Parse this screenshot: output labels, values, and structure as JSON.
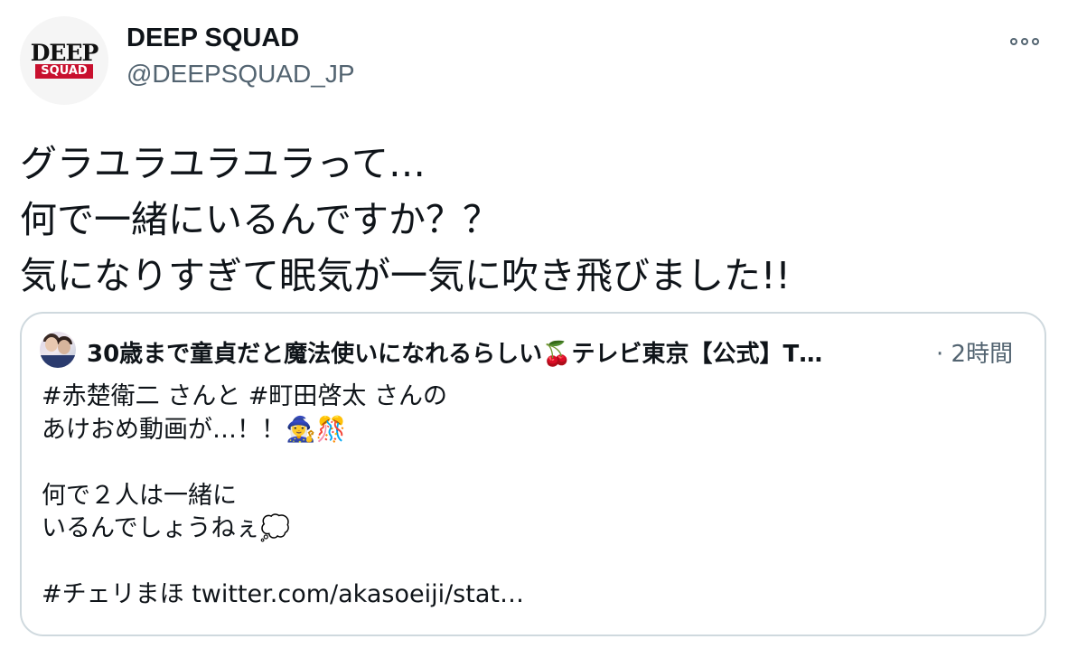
{
  "author": {
    "display_name": "DEEP SQUAD",
    "handle": "@DEEPSQUAD_JP",
    "avatar_logo_top": "DEEP",
    "avatar_logo_bottom": "SQUAD"
  },
  "more_icon": "more-horizontal-icon",
  "tweet_text": "グラユラユラユラって…\n何で一緒にいるんですか？？\n気になりすぎて眠気が一気に吹き飛びました!!",
  "quote": {
    "display_name": "30歳まで童貞だと魔法使いになれるらしい🍒テレビ東京【公式】T…",
    "time": "· 2時間",
    "text": "#赤楚衛二 さんと #町田啓太 さんの\nあけおめ動画が…！！🧙‍♀️🎊\n\n何で２人は一緒に\nいるんでしょうねぇ💭\n\n#チェリまほ twitter.com/akasoeiji/stat…"
  },
  "colors": {
    "text_primary": "#0f1419",
    "text_secondary": "#536471",
    "border": "#cfd9de",
    "logo_red": "#c8102e"
  }
}
